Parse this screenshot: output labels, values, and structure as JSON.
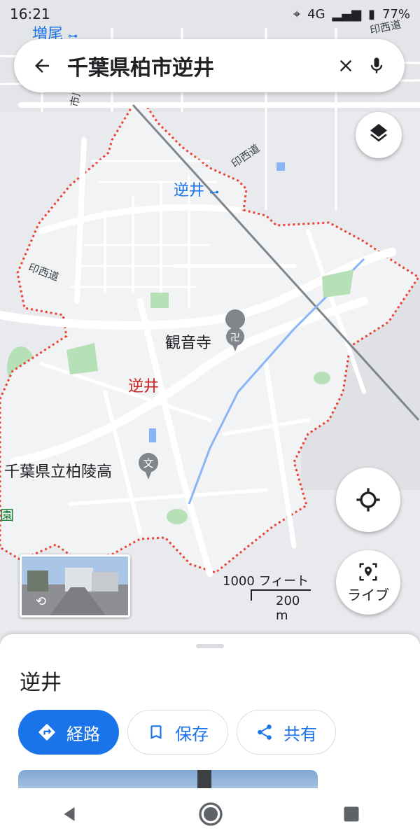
{
  "status_bar": {
    "time": "16:21",
    "network": "4G",
    "battery": "77%"
  },
  "search": {
    "query": "千葉県柏市逆井"
  },
  "map_labels": {
    "station_masuo": "増尾",
    "station_sakasai": "逆井",
    "area_name": "逆井",
    "temple": "観音寺",
    "school": "千葉県立柏陵高",
    "road_ichikawa": "市川柏線",
    "road_insai_1": "印西道",
    "road_insai_2": "印西道",
    "road_insai_3": "印西道",
    "edge_park": "園"
  },
  "scale": {
    "imperial": "1000 フィート",
    "metric": "200 m"
  },
  "live_button": {
    "label": "ライブ"
  },
  "place": {
    "title": "逆井",
    "actions": [
      {
        "label": "経路"
      },
      {
        "label": "保存"
      },
      {
        "label": "共有"
      }
    ]
  },
  "colors": {
    "accent": "#1a73e8",
    "boundary": "#ea4335",
    "park": "#b6e0b5",
    "water": "#8ab4f8"
  }
}
